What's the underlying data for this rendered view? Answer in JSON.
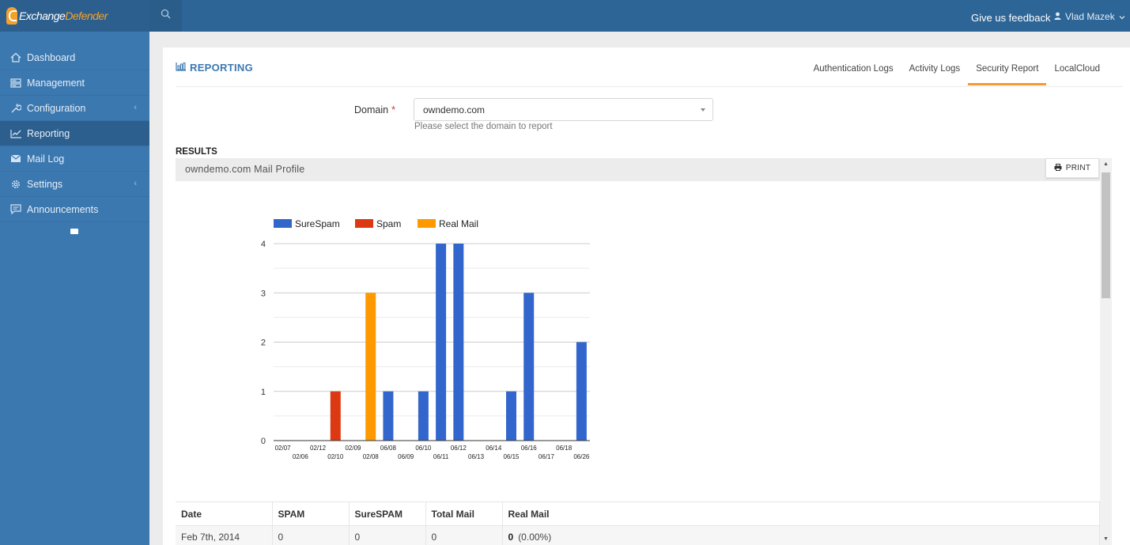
{
  "app": {
    "brand_prefix": "Exchange",
    "brand_suffix": "Defender"
  },
  "topbar": {
    "feedback_label": "Give us feedback",
    "user_name": "Vlad Mazek"
  },
  "sidebar": {
    "items": [
      {
        "label": "Dashboard",
        "icon": "home-icon"
      },
      {
        "label": "Management",
        "icon": "server-icon"
      },
      {
        "label": "Configuration",
        "icon": "wrench-icon",
        "has_submenu": true
      },
      {
        "label": "Reporting",
        "icon": "line-chart-icon",
        "active": true
      },
      {
        "label": "Mail Log",
        "icon": "envelope-icon"
      },
      {
        "label": "Settings",
        "icon": "gear-icon",
        "has_submenu": true
      },
      {
        "label": "Announcements",
        "icon": "comment-icon"
      }
    ]
  },
  "page": {
    "title": "REPORTING",
    "tabs": [
      {
        "label": "Authentication Logs",
        "active": false
      },
      {
        "label": "Activity Logs",
        "active": false
      },
      {
        "label": "Security Report",
        "active": true
      },
      {
        "label": "LocalCloud",
        "active": false
      }
    ]
  },
  "form": {
    "domain_label": "Domain",
    "required_mark": "*",
    "domain_value": "owndemo.com",
    "domain_help": "Please select the domain to report"
  },
  "results": {
    "title": "RESULTS",
    "profile_title": "owndemo.com Mail Profile",
    "print_label": "PRINT"
  },
  "colors": {
    "surespam": "#3366cc",
    "spam": "#dc3912",
    "realmail": "#ff9900",
    "accent": "#3c78b0",
    "tab_active": "#f39a2e"
  },
  "chart_data": {
    "type": "bar",
    "stacked": true,
    "categories": [
      "02/07",
      "02/06",
      "02/12",
      "02/10",
      "02/09",
      "02/08",
      "06/08",
      "06/09",
      "06/10",
      "06/11",
      "06/12",
      "06/13",
      "06/14",
      "06/15",
      "06/16",
      "06/17",
      "06/18",
      "06/26"
    ],
    "series": [
      {
        "name": "SureSpam",
        "values": [
          0,
          0,
          0,
          0,
          0,
          0,
          1,
          0,
          1,
          4,
          4,
          0,
          0,
          1,
          3,
          0,
          0,
          2
        ]
      },
      {
        "name": "Spam",
        "values": [
          0,
          0,
          0,
          1,
          0,
          0,
          0,
          0,
          0,
          0,
          0,
          0,
          0,
          0,
          0,
          0,
          0,
          0
        ]
      },
      {
        "name": "Real Mail",
        "values": [
          0,
          0,
          0,
          0,
          0,
          3,
          0,
          0,
          0,
          0,
          0,
          0,
          0,
          0,
          0,
          0,
          0,
          0
        ]
      }
    ],
    "yticks": [
      0,
      1,
      2,
      3,
      4
    ],
    "ylim": [
      0,
      4
    ],
    "legend_position": "top",
    "grid": true
  },
  "table": {
    "columns": [
      "Date",
      "SPAM",
      "SureSPAM",
      "Total Mail",
      "Real Mail"
    ],
    "rows": [
      {
        "date": "Feb 7th, 2014",
        "spam": "0",
        "surespam": "0",
        "total": "0",
        "real_count": "0",
        "real_pct": "(0.00%)"
      }
    ]
  }
}
